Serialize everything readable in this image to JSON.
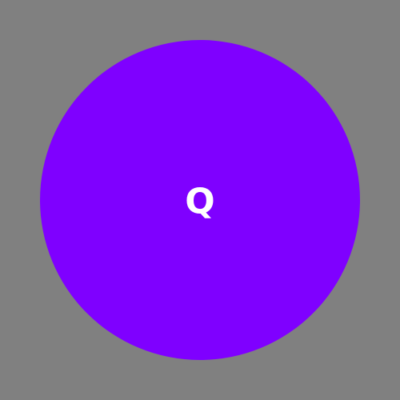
{
  "avatar": {
    "initial": "Q",
    "background_color": "#7F00FF",
    "text_color": "#FFFFFF"
  },
  "canvas": {
    "background_color": "#808080"
  }
}
